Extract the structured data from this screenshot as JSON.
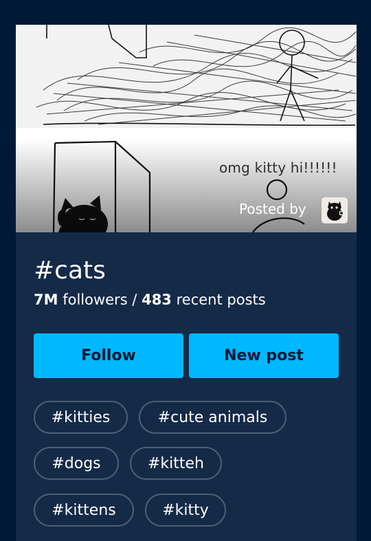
{
  "hero": {
    "caption": "omg kitty hi!!!!!!",
    "posted_by_label": "Posted by",
    "posted_by_avatar_icon": "cat-avatar-icon"
  },
  "tag": {
    "title": "#cats",
    "followers_count": "7M",
    "followers_label": "followers /",
    "posts_count": "483",
    "posts_label": "recent posts"
  },
  "actions": {
    "follow_label": "Follow",
    "new_post_label": "New post"
  },
  "related_tags": [
    "#kitties",
    "#cute animals",
    "#dogs",
    "#kitteh",
    "#kittens",
    "#kitty"
  ],
  "colors": {
    "page_bg": "#001935",
    "card_bg": "#152a47",
    "accent": "#00b8ff",
    "chip_border": "#4b6077"
  }
}
